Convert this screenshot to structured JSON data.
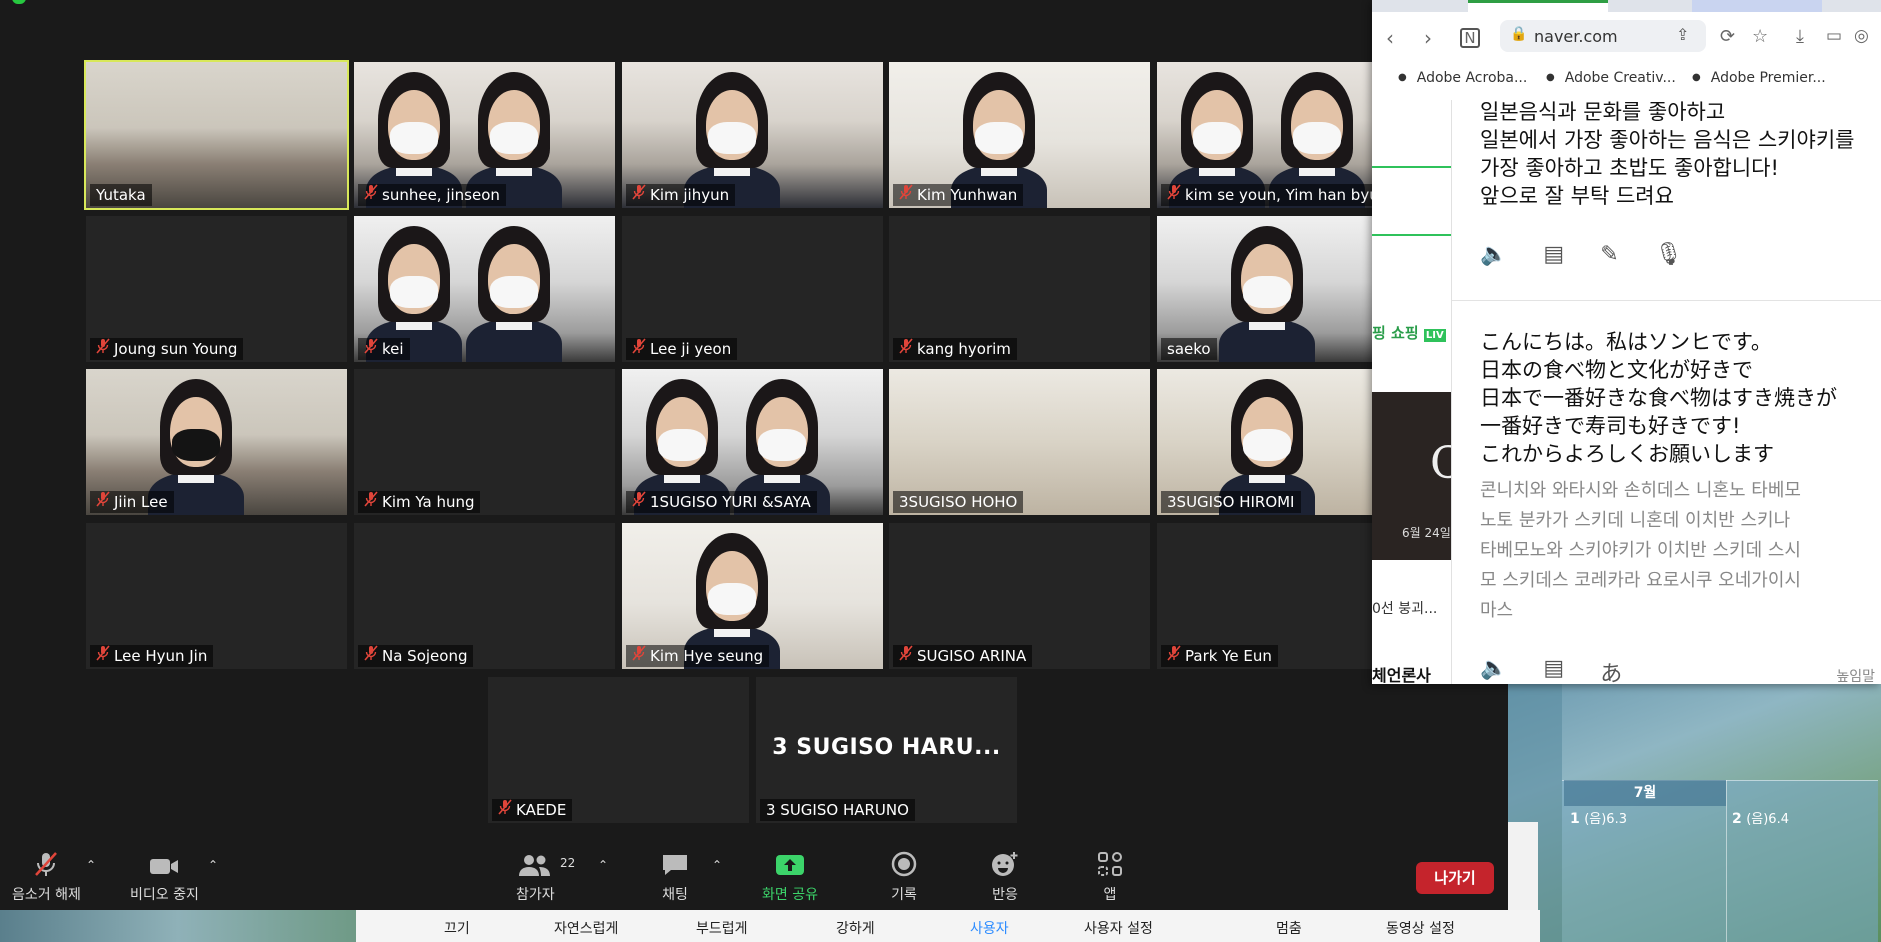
{
  "participants": [
    {
      "name": "Yutaka",
      "muted": false,
      "video": true,
      "active": true,
      "scene": "room"
    },
    {
      "name": "sunhee, jinseon",
      "muted": true,
      "video": true,
      "scene": "class"
    },
    {
      "name": "Kim jihyun",
      "muted": true,
      "video": true,
      "scene": "class"
    },
    {
      "name": "Kim Yunhwan",
      "muted": true,
      "video": true,
      "scene": "white"
    },
    {
      "name": "kim se youn, Yim han byul",
      "muted": true,
      "video": true,
      "scene": "class"
    },
    {
      "name": "Joung sun Young",
      "muted": true,
      "video": false
    },
    {
      "name": "kei",
      "muted": true,
      "video": true,
      "scene": "lab"
    },
    {
      "name": "Lee ji yeon",
      "muted": true,
      "video": false
    },
    {
      "name": "kang hyorim",
      "muted": true,
      "video": false
    },
    {
      "name": "saeko",
      "muted": false,
      "video": true,
      "scene": "lab"
    },
    {
      "name": "Jiin Lee",
      "muted": true,
      "video": true,
      "scene": "room"
    },
    {
      "name": "Kim Ya hung",
      "muted": true,
      "video": false
    },
    {
      "name": "1SUGISO YURI &SAYA",
      "muted": true,
      "video": true,
      "scene": "lab"
    },
    {
      "name": "3SUGISO HOHO",
      "muted": false,
      "video": true,
      "scene": "shelf"
    },
    {
      "name": "3SUGISO HIROMI",
      "muted": false,
      "video": true,
      "scene": "shelf"
    },
    {
      "name": "Lee Hyun Jin",
      "muted": true,
      "video": false
    },
    {
      "name": "Na Sojeong",
      "muted": true,
      "video": false
    },
    {
      "name": "Kim Hye seung",
      "muted": true,
      "video": true,
      "scene": "white"
    },
    {
      "name": "SUGISO ARINA",
      "muted": true,
      "video": false
    },
    {
      "name": "Park Ye Eun",
      "muted": true,
      "video": false
    },
    {
      "name": "KAEDE",
      "muted": true,
      "video": false
    },
    {
      "name": "3 SUGISO HARUNO",
      "muted": false,
      "video": false,
      "big_label": "3 SUGISO HARU..."
    }
  ],
  "toolbar": {
    "unmute_label": "음소거 해제",
    "video_label": "비디오 중지",
    "participants_label": "참가자",
    "participants_count": "22",
    "chat_label": "채팅",
    "share_label": "화면 공유",
    "record_label": "기록",
    "reactions_label": "반응",
    "apps_label": "앱",
    "leave_label": "나가기"
  },
  "colors": {
    "active_speaker": "#d8e85a",
    "share_green": "#3cd46a",
    "leave_red": "#c5242c",
    "mute_red": "#e0453a"
  },
  "caption_bar": {
    "items": [
      "끄기",
      "자연스럽게",
      "부드럽게",
      "강하게",
      "사용자",
      "사용자 설정",
      "멈춤",
      "동영상 설정"
    ],
    "active_index": 4
  },
  "browser": {
    "url": "naver.com",
    "bookmarks": [
      "Adobe Acroba...",
      "Adobe Creativ...",
      "Adobe Premier..."
    ],
    "left_panel": {
      "shop_text": "핑  쇼핑",
      "shop_badge": "LIV",
      "date_text": "6월 24일",
      "big_letter": "C",
      "news_text": "0선 붕괴...",
      "bottom_text": "체언론사"
    },
    "source_text": [
      "일본음식과 문화를 좋아하고",
      "일본에서 가장 좋아하는 음식은 스키야키를",
      "가장 좋아하고 초밥도 좋아합니다!",
      "앞으로 잘 부탁 드려요"
    ],
    "translated_text": [
      "こんにちは。私はソンヒです。",
      "日本の食べ物と文化が好きで",
      "日本で一番好きな食べ物はすき焼きが",
      "一番好きで寿司も好きです!",
      "これからよろしくお願いします"
    ],
    "pronunciation": [
      "콘니치와 와타시와 손히데스 니혼노 타베모",
      "노토 분카가 스키데 니혼데 이치반 스키나",
      "타베모노와 스키야키가 이치반 스키데 스시",
      "모 스키데스 코레카라 요로시쿠 오네가이시",
      "마스"
    ],
    "more_label": "높임말"
  },
  "wallpaper_calendar": {
    "month": "7월",
    "cells": [
      {
        "day": "1",
        "lunar": "(음)6.3"
      },
      {
        "day": "2",
        "lunar": "(음)6.4"
      }
    ]
  }
}
